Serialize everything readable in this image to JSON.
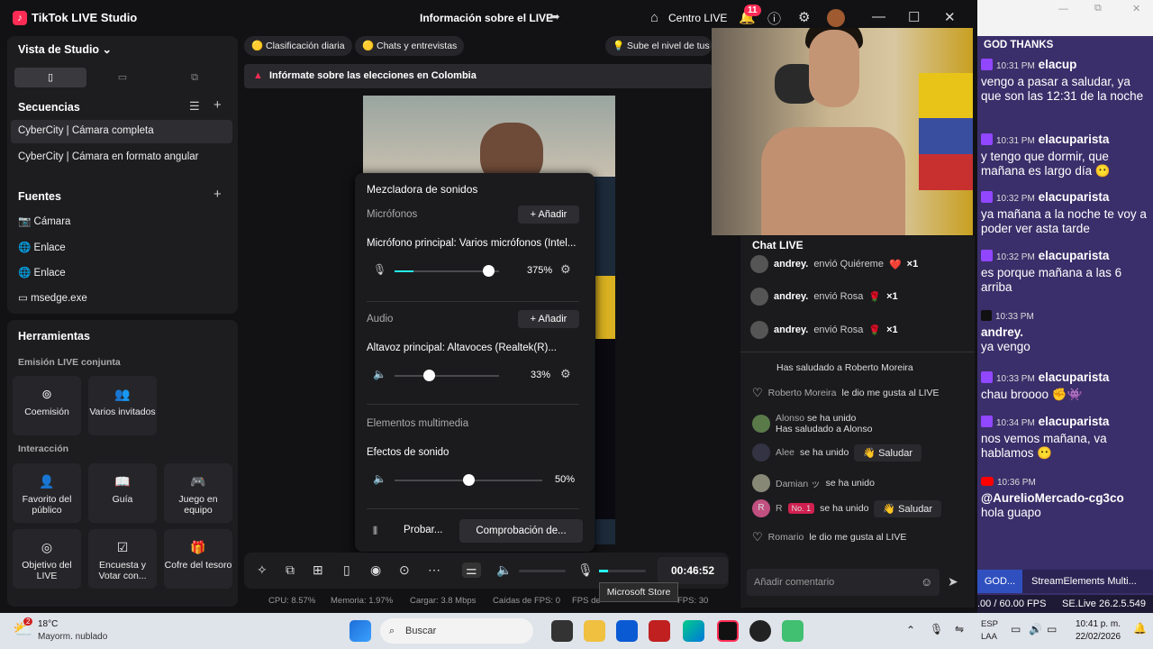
{
  "window": {
    "app_title": "TikTok LIVE Studio",
    "center_title": "Información sobre el LIVE",
    "centro": "Centro LIVE",
    "notif_count": "11"
  },
  "studio": {
    "view_label": "Vista de Studio ⌄",
    "sequences_label": "Secuencias",
    "sequences": [
      "CyberCity | Cámara completa",
      "CyberCity | Cámara en formato angular"
    ],
    "sources_label": "Fuentes",
    "sources": [
      {
        "icon": "📷",
        "label": "Cámara"
      },
      {
        "icon": "🌐",
        "label": "Enlace"
      },
      {
        "icon": "🌐",
        "label": "Enlace"
      },
      {
        "icon": "▭",
        "label": "msedge.exe"
      }
    ]
  },
  "tools": {
    "title": "Herramientas",
    "joint_label": "Emisión LIVE conjunta",
    "joint": [
      {
        "icon": "⊚",
        "label": "Coemisión"
      },
      {
        "icon": "👥",
        "label": "Varios invitados"
      }
    ],
    "interaction_label": "Interacción",
    "interaction": [
      {
        "icon": "👤",
        "label": "Favorito del público"
      },
      {
        "icon": "📖",
        "label": "Guía"
      },
      {
        "icon": "🎮",
        "label": "Juego en equipo"
      },
      {
        "icon": "◎",
        "label": "Objetivo del LIVE"
      },
      {
        "icon": "☑",
        "label": "Encuesta y Votar con..."
      },
      {
        "icon": "🎁",
        "label": "Cofre del tesoro"
      }
    ]
  },
  "pills": [
    "Clasificación diaria",
    "Chats y entrevistas",
    "Sube el nivel de tus"
  ],
  "banner": "Infórmate sobre las elecciones en Colombia",
  "mixer": {
    "title": "Mezcladora de sonidos",
    "mics_label": "Micrófonos",
    "add": "+ Añadir",
    "mic_name": "Micrófono principal: Varios micrófonos (Intel...",
    "mic_pct": "375%",
    "mic_level": 0.9,
    "audio_label": "Audio",
    "speaker_name": "Altavoz principal: Altavoces (Realtek(R)...",
    "speaker_pct": "33%",
    "speaker_level": 0.33,
    "media_label": "Elementos multimedia",
    "effects_label": "Efectos de sonido",
    "effects_pct": "50%",
    "effects_level": 0.5,
    "test_btn": "Probar...",
    "check_btn": "Comprobación de..."
  },
  "timer": "00:46:52",
  "stats": {
    "cpu": "CPU: 8.57%",
    "mem": "Memoria: 1.97%",
    "upload": "Cargar: 3.8 Mbps",
    "drops": "Caídas de FPS: 0",
    "fps_lbl": "FPS de",
    "fps": "FPS: 30"
  },
  "tooltip": "Microsoft Store",
  "chat": {
    "title": "Chat LIVE",
    "gifts": [
      {
        "user": "andrey.",
        "text": "envió Quiéreme",
        "count": "×1",
        "icon": "❤️"
      },
      {
        "user": "andrey.",
        "text": "envió Rosa",
        "count": "×1",
        "icon": "🌹"
      },
      {
        "user": "andrey.",
        "text": "envió Rosa",
        "count": "×1",
        "icon": "🌹"
      }
    ],
    "m1": "Has saludado a Roberto Moreira",
    "m2_user": "Roberto Moreira",
    "m2_text": "le dio me gusta al LIVE",
    "m3_user": "Alonso",
    "m3_text": "se ha unido",
    "m3_b": "Has saludado a Alonso",
    "m4_user": "Alee",
    "m4_text": "se ha unido",
    "saludar": "Saludar",
    "m5_user": "Damian ッ",
    "m5_text": "se ha unido",
    "m6_user": "R",
    "m6_badge": "No. 1",
    "m6_text": "se ha unido",
    "m7_user": "Romario",
    "m7_text": "le dio me gusta al LIVE",
    "placeholder": "Añadir comentario"
  },
  "stream_chat": {
    "header": "GOD THANKS",
    "messages": [
      {
        "platform": "tw",
        "time": "10:31 PM",
        "user": "elacup",
        "text": "vengo a pasar a saludar, ya que son las 12:31 de la noche"
      },
      {
        "platform": "tw",
        "time": "10:31 PM",
        "user": "elacuparista",
        "text": "y tengo que dormir, que mañana es largo día 😶"
      },
      {
        "platform": "tw",
        "time": "10:32 PM",
        "user": "elacuparista",
        "text": "ya mañana a la noche te voy a poder ver asta tarde"
      },
      {
        "platform": "tw",
        "time": "10:32 PM",
        "user": "elacuparista",
        "text": "es porque mañana a las 6 arriba"
      },
      {
        "platform": "tk",
        "time": "10:33 PM",
        "user": "andrey.",
        "text": "ya vengo"
      },
      {
        "platform": "tw",
        "time": "10:33 PM",
        "user": "elacuparista",
        "text": "chau broooo ✊👾"
      },
      {
        "platform": "tw",
        "time": "10:34 PM",
        "user": "elacuparista",
        "text": "nos vemos mañana, va hablamos 😶"
      },
      {
        "platform": "yt",
        "time": "10:36 PM",
        "user": "@AurelioMercado-cg3co",
        "text": "hola guapo"
      }
    ],
    "tab1": "GOD...",
    "tab2": "StreamElements Multi...",
    "fps": ".00 / 60.00 FPS",
    "version": "SE.Live 26.2.5.549"
  },
  "taskbar": {
    "temp": "18°C",
    "weather": "Mayorm. nublado",
    "weather_badge": "2",
    "search": "Buscar",
    "lang1": "ESP",
    "lang2": "LAA",
    "time": "10:41 p. m.",
    "date": "22/02/2026"
  }
}
